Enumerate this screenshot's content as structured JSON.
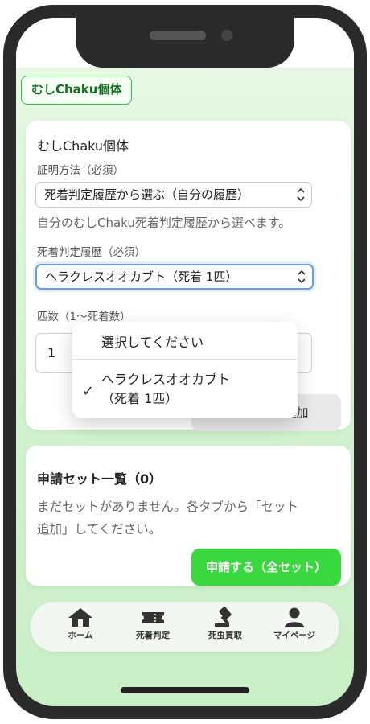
{
  "app_tag": "むしChaku個体",
  "form_card": {
    "title": "むしChaku個体",
    "method_label": "証明方法（必須）",
    "method_value": "死着判定履歴から選ぶ（自分の履歴）",
    "method_help": "自分のむしChaku死着判定履歴から選べます。",
    "history_label": "死着判定履歴（必須）",
    "history_value": "ヘラクレスオオカブト（死着 1匹）",
    "qty_label": "匹数（1〜死着数）",
    "qty_value": "1",
    "add_set_button": "申請セット追加"
  },
  "dropdown": {
    "option_1": "選択してください",
    "option_2_line1": "ヘラクレスオオカブト",
    "option_2_line2": "（死着 1匹）",
    "checkmark": "✓"
  },
  "list_card": {
    "title": "申請セット一覧（0）",
    "empty_line1": "まだセットがありません。各タブから「セット",
    "empty_line2": "追加」してください。",
    "submit_button": "申請する（全セット）"
  },
  "bottom_nav": {
    "home": "ホーム",
    "judge": "死着判定",
    "buyback": "死虫買取",
    "mypage": "マイページ"
  },
  "icons": {
    "select_arrow": "⇕",
    "home": "home-icon",
    "ticket": "ticket-icon",
    "gavel": "gavel-icon",
    "user": "user-icon"
  }
}
